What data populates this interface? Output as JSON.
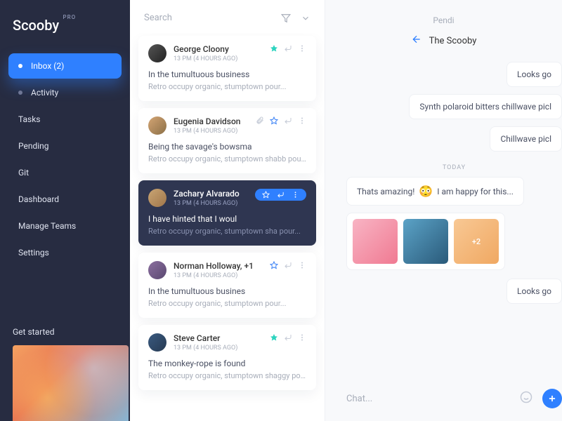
{
  "brand": {
    "name": "Scooby",
    "badge": "PRO"
  },
  "sidebar": {
    "items": [
      {
        "label": "Inbox (2)",
        "active": true
      },
      {
        "label": "Activity"
      },
      {
        "label": "Tasks"
      },
      {
        "label": "Pending"
      },
      {
        "label": "Git"
      },
      {
        "label": "Dashboard"
      },
      {
        "label": "Manage Teams"
      },
      {
        "label": "Settings"
      }
    ],
    "get_started": "Get started"
  },
  "search": {
    "placeholder": "Search"
  },
  "messages": [
    {
      "name": "George Cloony",
      "time": "13 PM (4 HOURS AGO)",
      "subject": "In the tumultuous business",
      "preview": "Retro occupy organic, stumptown pour..."
    },
    {
      "name": "Eugenia Davidson",
      "time": "13 PM (4 HOURS AGO)",
      "subject": "Being the savage's bowsma",
      "preview": "Retro occupy organic, stumptown shabb pour..."
    },
    {
      "name": "Zachary Alvarado",
      "time": "13 PM (4 HOURS AGO)",
      "subject": "I have hinted that I woul",
      "preview": "Retro occupy organic, stumptown sha pour..."
    },
    {
      "name": "Norman Holloway, +1",
      "time": "13 PM (4 HOURS AGO)",
      "subject": "In the tumultuous busines",
      "preview": "Retro occupy organic, stumptown pour..."
    },
    {
      "name": "Steve Carter",
      "time": "13 PM (4 HOURS AGO)",
      "subject": "The monkey-rope is found",
      "preview": "Retro occupy organic, stumptown shaggy pour..."
    }
  ],
  "chat": {
    "header_status": "Pendi",
    "title": "The Scooby",
    "bubbles": {
      "b1": "Looks go",
      "b2": "Synth polaroid bitters chillwave picl",
      "b3": "Chillwave picl",
      "divider": "TODAY",
      "b4a": "Thats amazing!",
      "b4b": "I am happy for this...",
      "more": "+2",
      "b5": "Looks go"
    },
    "input_placeholder": "Chat..."
  }
}
